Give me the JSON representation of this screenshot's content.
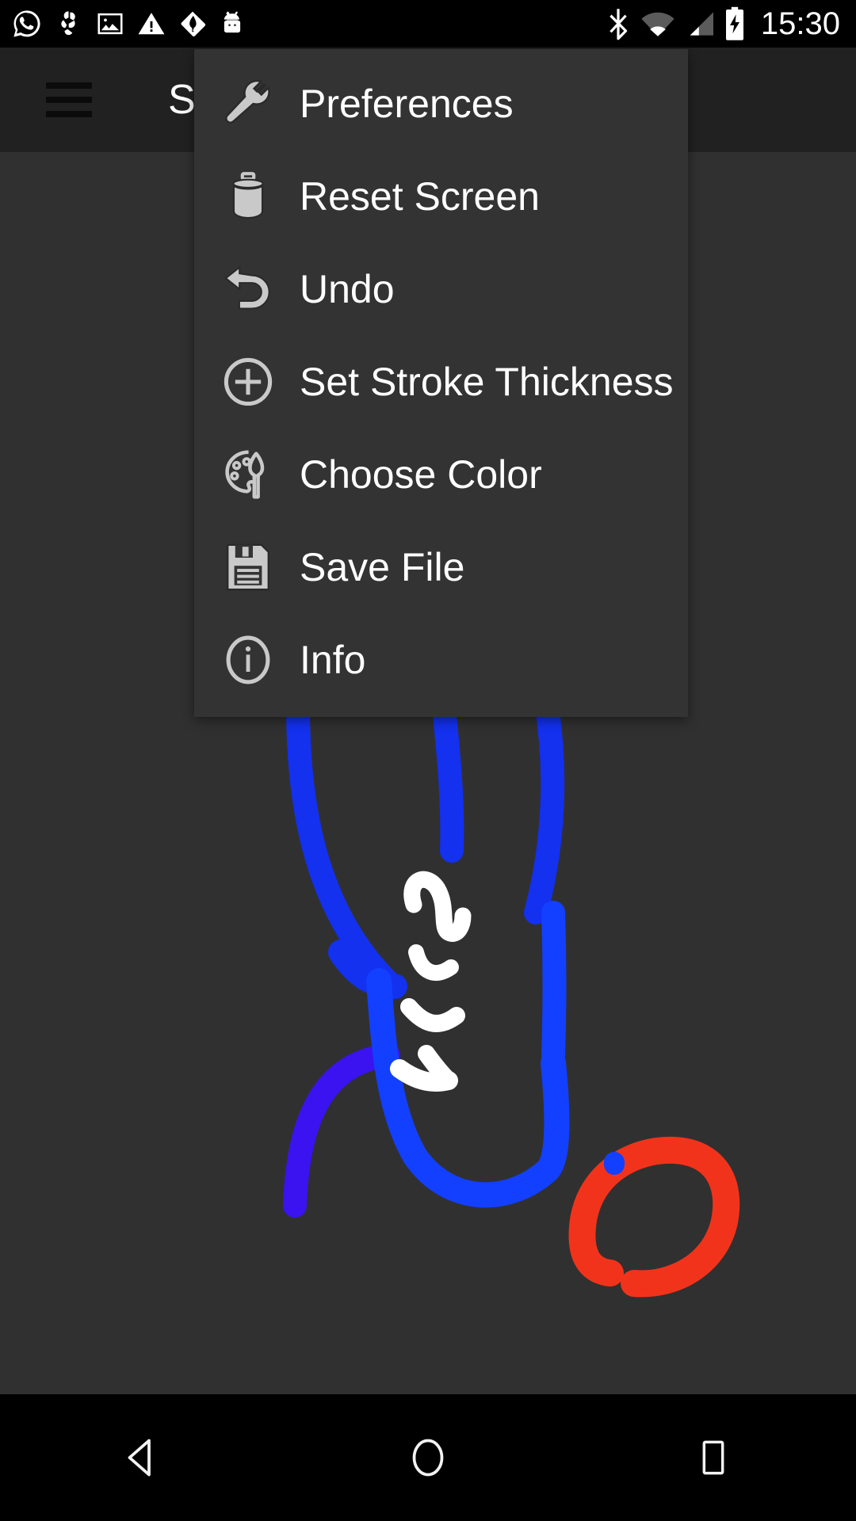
{
  "status_bar": {
    "left_icons": [
      {
        "name": "whatsapp-icon",
        "label": "WhatsApp"
      },
      {
        "name": "pinwheel-icon",
        "label": "Pinwheel"
      },
      {
        "name": "image-icon",
        "label": "Screenshot"
      },
      {
        "name": "warning-icon",
        "label": "Warning"
      },
      {
        "name": "leaf-notification-icon",
        "label": "Notification"
      },
      {
        "name": "android-robot-icon",
        "label": "Android"
      }
    ],
    "right_icons": [
      {
        "name": "bluetooth-icon",
        "label": "Bluetooth"
      },
      {
        "name": "wifi-icon",
        "label": "Wi-Fi"
      },
      {
        "name": "cellular-signal-icon",
        "label": "Signal"
      },
      {
        "name": "battery-charging-icon",
        "label": "Battery charging"
      }
    ],
    "clock": "15:30"
  },
  "app_bar": {
    "menu_icon": "hamburger-icon",
    "title": "Scr",
    "title_full": "Scr"
  },
  "popup_menu": {
    "items": [
      {
        "icon": "wrench-icon",
        "label": "Preferences"
      },
      {
        "icon": "trash-icon",
        "label": "Reset Screen"
      },
      {
        "icon": "undo-arrow-icon",
        "label": "Undo"
      },
      {
        "icon": "plus-circle-icon",
        "label": "Set Stroke Thickness"
      },
      {
        "icon": "palette-icon",
        "label": "Choose Color"
      },
      {
        "icon": "floppy-disk-icon",
        "label": "Save File"
      },
      {
        "icon": "info-circle-icon",
        "label": "Info"
      }
    ]
  },
  "canvas": {
    "background_color": "#303030",
    "stroke_colors": {
      "blue": "#1331ef",
      "bright_blue": "#1340ff",
      "violet": "#3a13f0",
      "red": "#f2331b",
      "white": "#ffffff",
      "green": "#19c419"
    }
  },
  "nav_bar": {
    "buttons": [
      {
        "name": "back-button",
        "icon": "triangle-left-icon"
      },
      {
        "name": "home-button",
        "icon": "circle-icon"
      },
      {
        "name": "recents-button",
        "icon": "square-icon"
      }
    ]
  },
  "colors": {
    "status_bar_bg": "#000000",
    "app_bar_bg": "#212121",
    "menu_bg": "#333333",
    "canvas_bg": "#303030",
    "nav_bar_bg": "#000000",
    "text_primary": "#ffffff",
    "icon_gray": "#c4c4c4"
  }
}
